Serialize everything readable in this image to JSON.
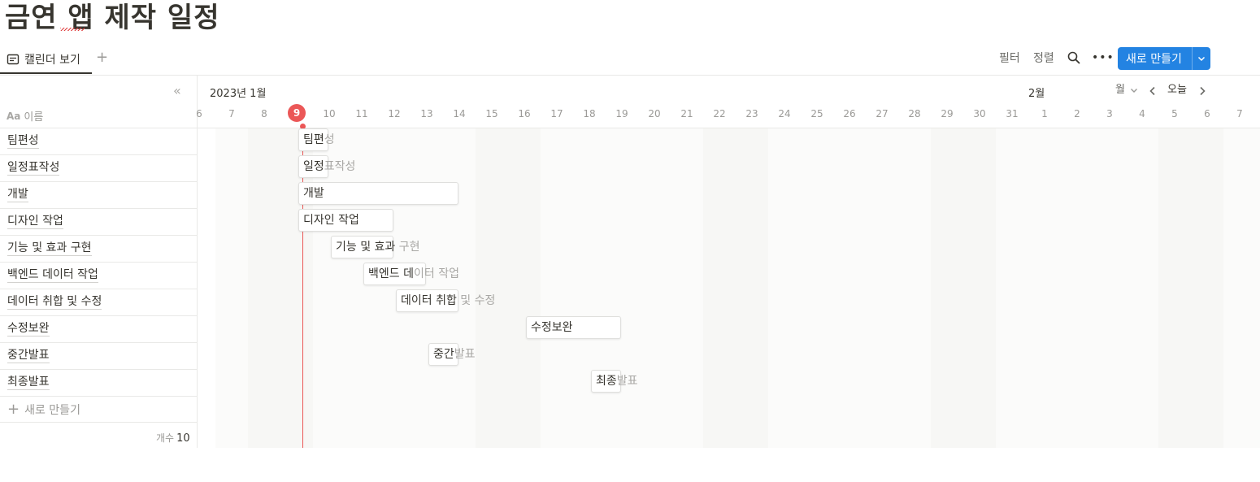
{
  "page": {
    "title": "금연 앱 제작 일정"
  },
  "views": {
    "active_tab": "캘린더 보기",
    "add_icon": "plus-icon"
  },
  "toolbar": {
    "filter": "필터",
    "sort": "정렬",
    "search_icon": "search-icon",
    "more_icon": "more-icon",
    "new_label": "새로 만들기"
  },
  "table": {
    "name_header": "이름",
    "rows": [
      "팀편성",
      "일정표작성",
      "개발",
      "디자인 작업",
      "기능 및 효과 구현",
      "백엔드 데이터 작업",
      "데이터 취합 및 수정",
      "수정보완",
      "중간발표",
      "최종발표"
    ],
    "new_row": "새로 만들기",
    "count_label": "개수",
    "count_value": "10"
  },
  "timeline": {
    "month_label": "2023년 1월",
    "next_month_label": "2월",
    "scale_label": "월",
    "today_label": "오늘",
    "today_day": "9",
    "days": [
      "6",
      "7",
      "8",
      "9",
      "10",
      "11",
      "12",
      "13",
      "14",
      "15",
      "16",
      "17",
      "18",
      "19",
      "20",
      "21",
      "22",
      "23",
      "24",
      "25",
      "26",
      "27",
      "28",
      "29",
      "30",
      "31",
      "1",
      "2",
      "3",
      "4",
      "5",
      "6",
      "7"
    ],
    "weekend_color": "#f7f7f5",
    "weekday_color": "#fbfbfa",
    "today_color": "#eb5757",
    "accent": "#2383e2"
  },
  "tasks": [
    {
      "name": "팀편성",
      "shown": "팀편",
      "rest": "성",
      "start": "2023-01-09",
      "end": "2023-01-09"
    },
    {
      "name": "일정표작성",
      "shown": "일정",
      "rest": "표작성",
      "start": "2023-01-09",
      "end": "2023-01-09"
    },
    {
      "name": "개발",
      "shown": "개발",
      "rest": "",
      "start": "2023-01-09",
      "end": "2023-01-13"
    },
    {
      "name": "디자인 작업",
      "shown": "디자인 작업",
      "rest": "",
      "start": "2023-01-09",
      "end": "2023-01-11"
    },
    {
      "name": "기능 및 효과 구현",
      "shown": "기능 및 효과",
      "rest": " 구현",
      "start": "2023-01-10",
      "end": "2023-01-11"
    },
    {
      "name": "백엔드 데이터 작업",
      "shown": "백엔드 데",
      "rest": "이터 작업",
      "start": "2023-01-11",
      "end": "2023-01-12"
    },
    {
      "name": "데이터 취합 및 수정",
      "shown": "데이터 취합",
      "rest": " 및 수정",
      "start": "2023-01-12",
      "end": "2023-01-13"
    },
    {
      "name": "수정보완",
      "shown": "수정보완",
      "rest": "",
      "start": "2023-01-16",
      "end": "2023-01-18"
    },
    {
      "name": "중간발표",
      "shown": "중간",
      "rest": "발표",
      "start": "2023-01-13",
      "end": "2023-01-13"
    },
    {
      "name": "최종발표",
      "shown": "최종",
      "rest": "발표",
      "start": "2023-01-18",
      "end": "2023-01-18"
    }
  ]
}
